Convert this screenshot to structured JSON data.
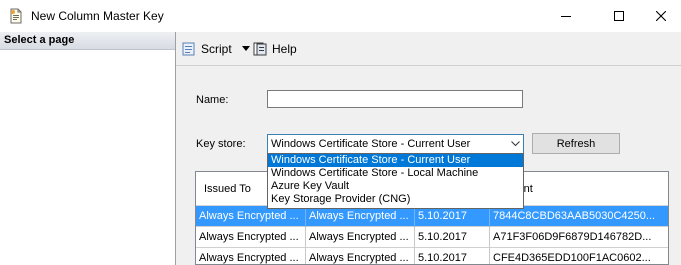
{
  "window": {
    "title": "New Column Master Key",
    "icon": "document-icon"
  },
  "left_pane": {
    "header": "Select a page"
  },
  "toolbar": {
    "script_label": "Script",
    "help_label": "Help"
  },
  "form": {
    "name_label": "Name:",
    "name_value": "",
    "keystore_label": "Key store:",
    "keystore_selected": "Windows Certificate Store - Current User",
    "refresh_label": "Refresh"
  },
  "dropdown": {
    "options": [
      "Windows Certificate Store - Current User",
      "Windows Certificate Store - Local Machine",
      "Azure Key Vault",
      "Key Storage Provider (CNG)"
    ],
    "highlighted_index": 0
  },
  "grid": {
    "columns": [
      "Issued To",
      "",
      "",
      "umbprint"
    ],
    "rows": [
      [
        "Always Encrypted ...",
        "Always Encrypted ...",
        "5.10.2017",
        "7844C8CBD63AAB5030C4250..."
      ],
      [
        "Always Encrypted ...",
        "Always Encrypted ...",
        "5.10.2017",
        "A71F3F06D9F6879D146782D..."
      ],
      [
        "Always Encrypted ...",
        "Always Encrypted ...",
        "5.10.2017",
        "CFE4D365EDD100F1AC0602..."
      ]
    ],
    "selected_row": 0
  },
  "colors": {
    "selection": "#3399ff",
    "dropdown_highlight": "#0078d7",
    "combo_border": "#3c7fb1"
  }
}
